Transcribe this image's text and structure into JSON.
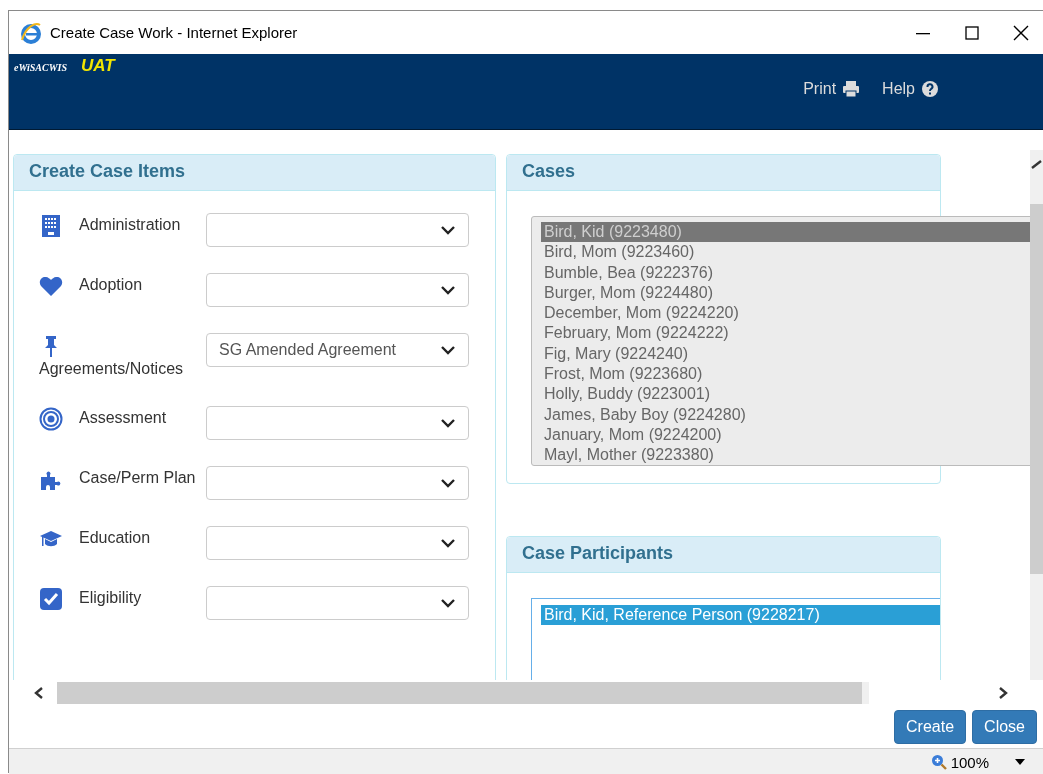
{
  "window": {
    "title": "Create Case Work - Internet Explorer"
  },
  "header": {
    "app_name": "eWiSACWIS",
    "environment": "UAT",
    "links": [
      {
        "label": "Print"
      },
      {
        "label": "Help"
      }
    ]
  },
  "create_case_items": {
    "title": "Create Case Items",
    "items": [
      {
        "label": "Administration"
      },
      {
        "label": "Adoption"
      },
      {
        "label": "Agreements/Notices",
        "value": "SG Amended Agreement"
      },
      {
        "label": "Assessment"
      },
      {
        "label": "Case/Perm Plan"
      },
      {
        "label": "Education"
      },
      {
        "label": "Eligibility"
      }
    ]
  },
  "cases": {
    "title": "Cases",
    "items": [
      {
        "label": "Bird, Kid (9223480)",
        "selected": true
      },
      {
        "label": "Bird, Mom (9223460)",
        "selected": false
      },
      {
        "label": "Bumble, Bea (9222376)",
        "selected": false
      },
      {
        "label": "Burger, Mom (9224480)",
        "selected": false
      },
      {
        "label": "December, Mom (9224220)",
        "selected": false
      },
      {
        "label": "February, Mom (9224222)",
        "selected": false
      },
      {
        "label": "Fig, Mary (9224240)",
        "selected": false
      },
      {
        "label": "Frost, Mom (9223680)",
        "selected": false
      },
      {
        "label": "Holly, Buddy (9223001)",
        "selected": false
      },
      {
        "label": "James, Baby Boy (9224280)",
        "selected": false
      },
      {
        "label": "January, Mom (9224200)",
        "selected": false
      },
      {
        "label": "Mayl, Mother (9223380)",
        "selected": false
      }
    ]
  },
  "case_participants": {
    "title": "Case Participants",
    "items": [
      {
        "label": "Bird, Kid, Reference Person (9228217)",
        "selected": true
      }
    ]
  },
  "buttons": [
    {
      "label": "Create"
    },
    {
      "label": "Close"
    }
  ],
  "status_bar": {
    "zoom": "100%"
  }
}
